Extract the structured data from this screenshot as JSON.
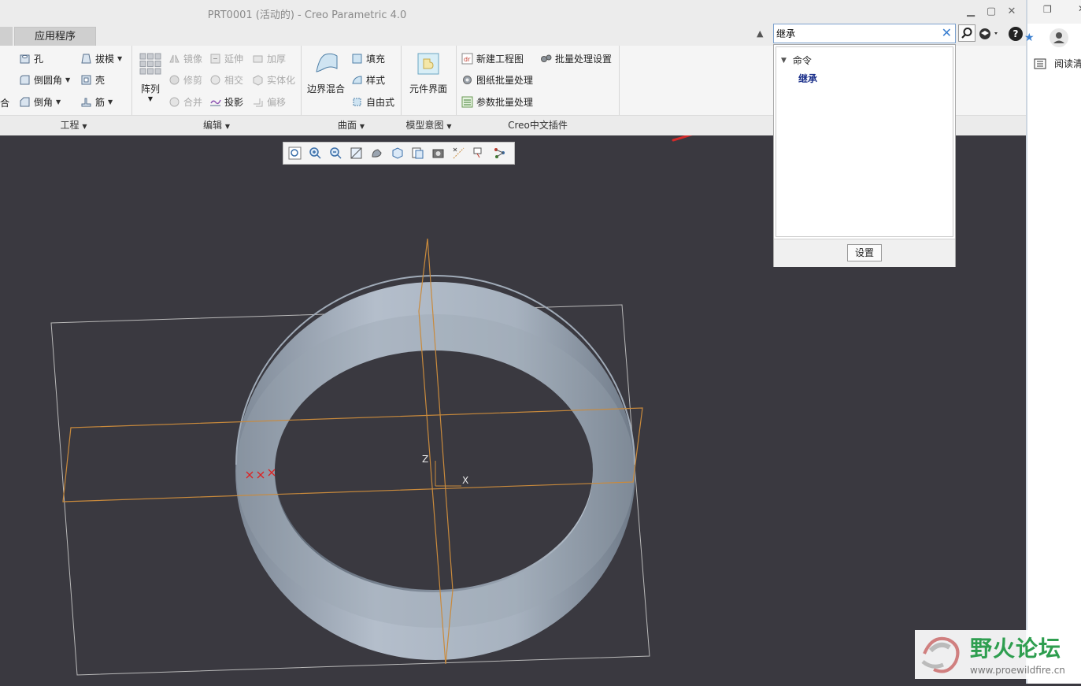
{
  "window": {
    "title": "PRT0001 (活动的) - Creo Parametric 4.0",
    "minimize": "▁",
    "maximize": "▢",
    "close": "✕"
  },
  "tabs": {
    "active": "应用程序"
  },
  "ribbon": {
    "cut_label": "合",
    "engineering": {
      "hole": "孔",
      "round": "倒圆角",
      "chamfer": "倒角",
      "draft": "拔模",
      "shell": "壳",
      "rib": "筋",
      "group_label": "工程"
    },
    "editing": {
      "pattern": "阵列",
      "mirror": "镜像",
      "trim": "修剪",
      "merge": "合并",
      "extend": "延伸",
      "intersect": "相交",
      "project": "投影",
      "thicken": "加厚",
      "solidify": "实体化",
      "offset": "偏移",
      "group_label": "编辑"
    },
    "surfaces": {
      "boundary_blend": "边界混合",
      "fill": "填充",
      "style": "样式",
      "freestyle": "自由式",
      "group_label": "曲面"
    },
    "model_intent": {
      "component_interface": "元件界面",
      "group_label": "模型意图"
    },
    "plugins": {
      "new_drawing": "新建工程图",
      "batch_settings": "批量处理设置",
      "drawing_batch": "图纸批量处理",
      "param_batch": "参数批量处理",
      "group_label": "Creo中文插件"
    }
  },
  "search": {
    "value": "继承",
    "category": "命令",
    "result": "继承",
    "settings_button": "设置"
  },
  "right_strip": {
    "reading_label": "阅读清"
  },
  "axes": {
    "z": "Z",
    "x": "X"
  },
  "watermark": {
    "title": "野火论坛",
    "url": "www.proewildfire.cn"
  },
  "colors": {
    "accent_arrow": "#d42a2a",
    "ring": "#a3afbd",
    "datum": "#c98a3c",
    "viewport": "#3a3940"
  }
}
